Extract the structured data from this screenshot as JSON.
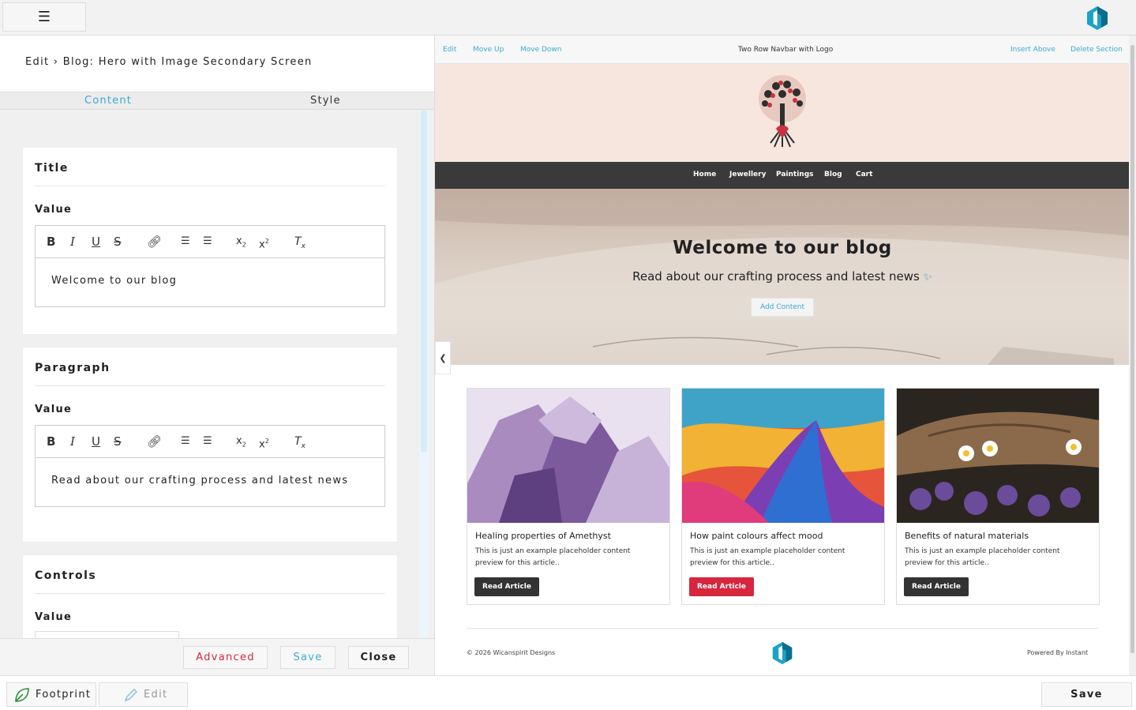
{
  "topbar": {
    "menu_icon": "☰",
    "brand_icon": "hex-logo"
  },
  "editor": {
    "heading": "Edit › Blog: Hero with Image Secondary Screen",
    "tabs": [
      {
        "label": "Content"
      },
      {
        "label": "Style"
      }
    ],
    "cards": [
      {
        "title": "Title",
        "value_label": "Value",
        "text": "Welcome to our blog"
      },
      {
        "title": "Paragraph",
        "value_label": "Value",
        "text": "Read about our crafting process and latest news"
      },
      {
        "title": "Controls",
        "value_label": "Value"
      }
    ],
    "toolbar_icons": [
      "bold-icon",
      "italic-icon",
      "underline-icon",
      "strikethrough-icon",
      "link-icon",
      "ordered-list-icon",
      "bullet-list-icon",
      "subscript-icon",
      "superscript-icon",
      "clear-format-icon"
    ],
    "actions": {
      "advanced": "Advanced",
      "save": "Save",
      "close": "Close"
    }
  },
  "bottombar": {
    "footprint": "Footprint",
    "edit": "Edit",
    "save": "Save"
  },
  "preview": {
    "section_bar": {
      "edit": "Edit",
      "move_up": "Move Up",
      "move_down": "Move Down",
      "title": "Two Row Navbar with Logo",
      "insert_above": "Insert Above",
      "delete_section": "Delete Section"
    },
    "nav": [
      "Home",
      "Jewellery",
      "Paintings",
      "Blog",
      "Cart"
    ],
    "hero": {
      "title": "Welcome to our blog",
      "subtitle": "Read about our crafting process and latest news",
      "add_content": "Add Content"
    },
    "articles": [
      {
        "title": "Healing properties of Amethyst",
        "text": "This is just an example placeholder content preview for this article..",
        "button": "Read Article",
        "button_color": "#333333"
      },
      {
        "title": "How paint colours affect mood",
        "text": "This is just an example placeholder content preview for this article..",
        "button": "Read Article",
        "button_color": "#d7263d"
      },
      {
        "title": "Benefits of natural materials",
        "text": "This is just an example placeholder content preview for this article..",
        "button": "Read Article",
        "button_color": "#333333"
      }
    ],
    "footer": {
      "copyright": "© 2026 Wicanspirit Designs",
      "powered": "Powered By Instant"
    }
  },
  "colors": {
    "accent": "#3ba9d4",
    "danger": "#d7263d",
    "nav_bg": "#3a3a3a"
  }
}
